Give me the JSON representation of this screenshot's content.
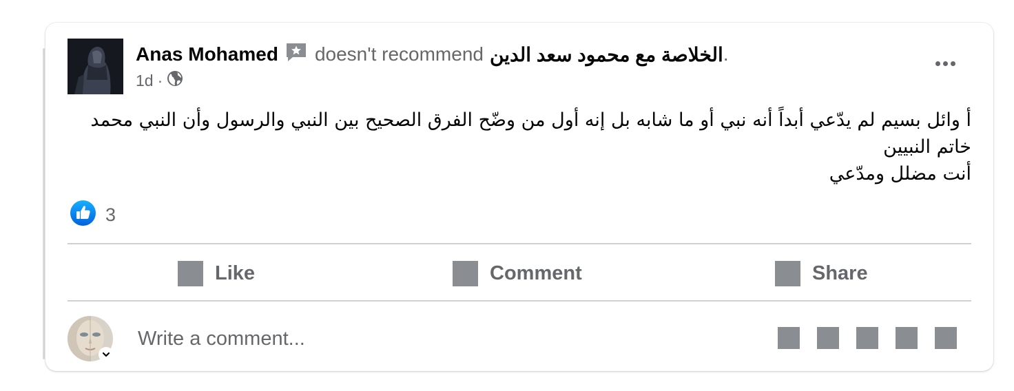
{
  "post": {
    "author": "Anas Mohamed",
    "action_text": "doesn't recommend",
    "page_name": "الخلاصة مع محمود سعد الدين",
    "trailing_period": ".",
    "timestamp": "1d",
    "separator": "·",
    "audience_icon": "globe-icon",
    "badge_icon": "review-star-icon",
    "body_lines": [
      "أ وائل بسيم لم يدّعي أبداً أنه نبي أو ما شابه بل إنه أول من وضّح الفرق الصحيح بين النبي والرسول وأن النبي محمد",
      "خاتم النبيين",
      "أنت مضلل ومدّعي"
    ],
    "reaction_icon": "like-reaction-icon",
    "reaction_count": "3"
  },
  "actions": {
    "like_label": "Like",
    "comment_label": "Comment",
    "share_label": "Share"
  },
  "comment_box": {
    "placeholder": "Write a comment...",
    "tool_icons": [
      "emoji-icon",
      "camera-icon",
      "gif-icon",
      "sticker-icon",
      "avatar-sticker-icon"
    ]
  },
  "colors": {
    "secondary_text": "#65676b",
    "primary_text": "#050505",
    "like_blue": "#1877f2",
    "divider": "#ced0d4",
    "icon_gray": "#8a8d91"
  }
}
